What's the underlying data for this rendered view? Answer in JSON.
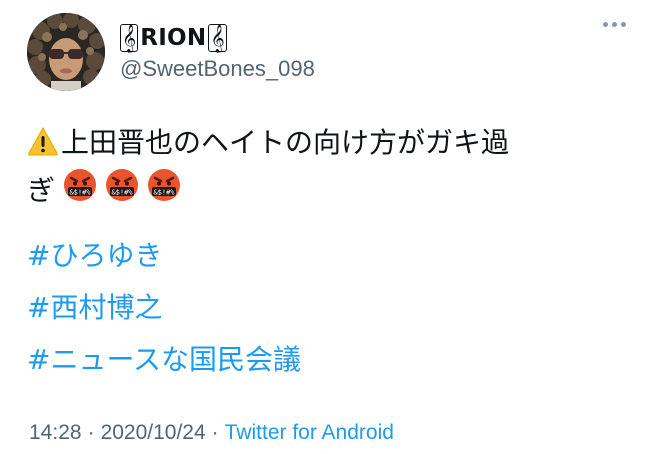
{
  "author": {
    "display_name": "RION",
    "handle": "@SweetBones_098"
  },
  "tweet": {
    "line1": "上田晋也のヘイトの向け方がガキ過",
    "line2": "ぎ",
    "hashtags": [
      "#ひろゆき",
      "#西村博之",
      "#ニュースな国民会議"
    ]
  },
  "footer": {
    "time": "14:28",
    "date": "2020/10/24",
    "source": "Twitter for Android",
    "separator": "·"
  },
  "colors": {
    "link": "#1d9bf0",
    "muted": "#536471",
    "text": "#0f1419",
    "warning": "#f6c231",
    "angry": "#e8542b"
  }
}
